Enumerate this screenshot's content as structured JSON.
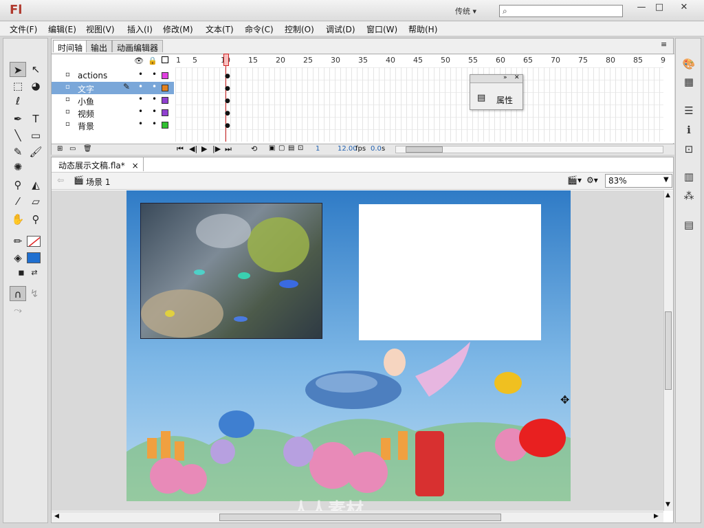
{
  "app": {
    "logo": "Fl",
    "workspace": "传统 ▾",
    "search_placeholder": ""
  },
  "window_controls": {
    "minimize": "—",
    "maximize": "□",
    "close": "✕"
  },
  "menu": [
    "文件(F)",
    "编辑(E)",
    "视图(V)",
    "插入(I)",
    "修改(M)",
    "文本(T)",
    "命令(C)",
    "控制(O)",
    "调试(D)",
    "窗口(W)",
    "帮助(H)"
  ],
  "timeline": {
    "tabs": [
      "时间轴",
      "输出",
      "动画编辑器"
    ],
    "frame_numbers": [
      "1",
      "5",
      "10",
      "15",
      "20",
      "25",
      "30",
      "35",
      "40",
      "45",
      "50",
      "55",
      "60",
      "65",
      "70",
      "75",
      "80",
      "85",
      "9"
    ],
    "layers": [
      {
        "name": "actions",
        "color": "#e040e0",
        "selected": false
      },
      {
        "name": "文字",
        "color": "#e08020",
        "selected": true
      },
      {
        "name": "小鱼",
        "color": "#9040d0",
        "selected": false
      },
      {
        "name": "视频",
        "color": "#9040d0",
        "selected": false
      },
      {
        "name": "背景",
        "color": "#30c030",
        "selected": false
      }
    ],
    "status": {
      "frame": "1",
      "fps": "12.00",
      "fps_unit": "fps",
      "time": "0.0",
      "time_unit": "s"
    }
  },
  "properties_panel": {
    "label": "属性"
  },
  "document": {
    "tab_title": "动态展示文稿.fla*",
    "tab_close": "×",
    "scene": "场景 1",
    "zoom": "83%"
  },
  "watermark": "人人素材",
  "colors": {
    "selection": "#7aa7d9",
    "stroke": "#e02020",
    "fill": "#1f6fd0"
  }
}
